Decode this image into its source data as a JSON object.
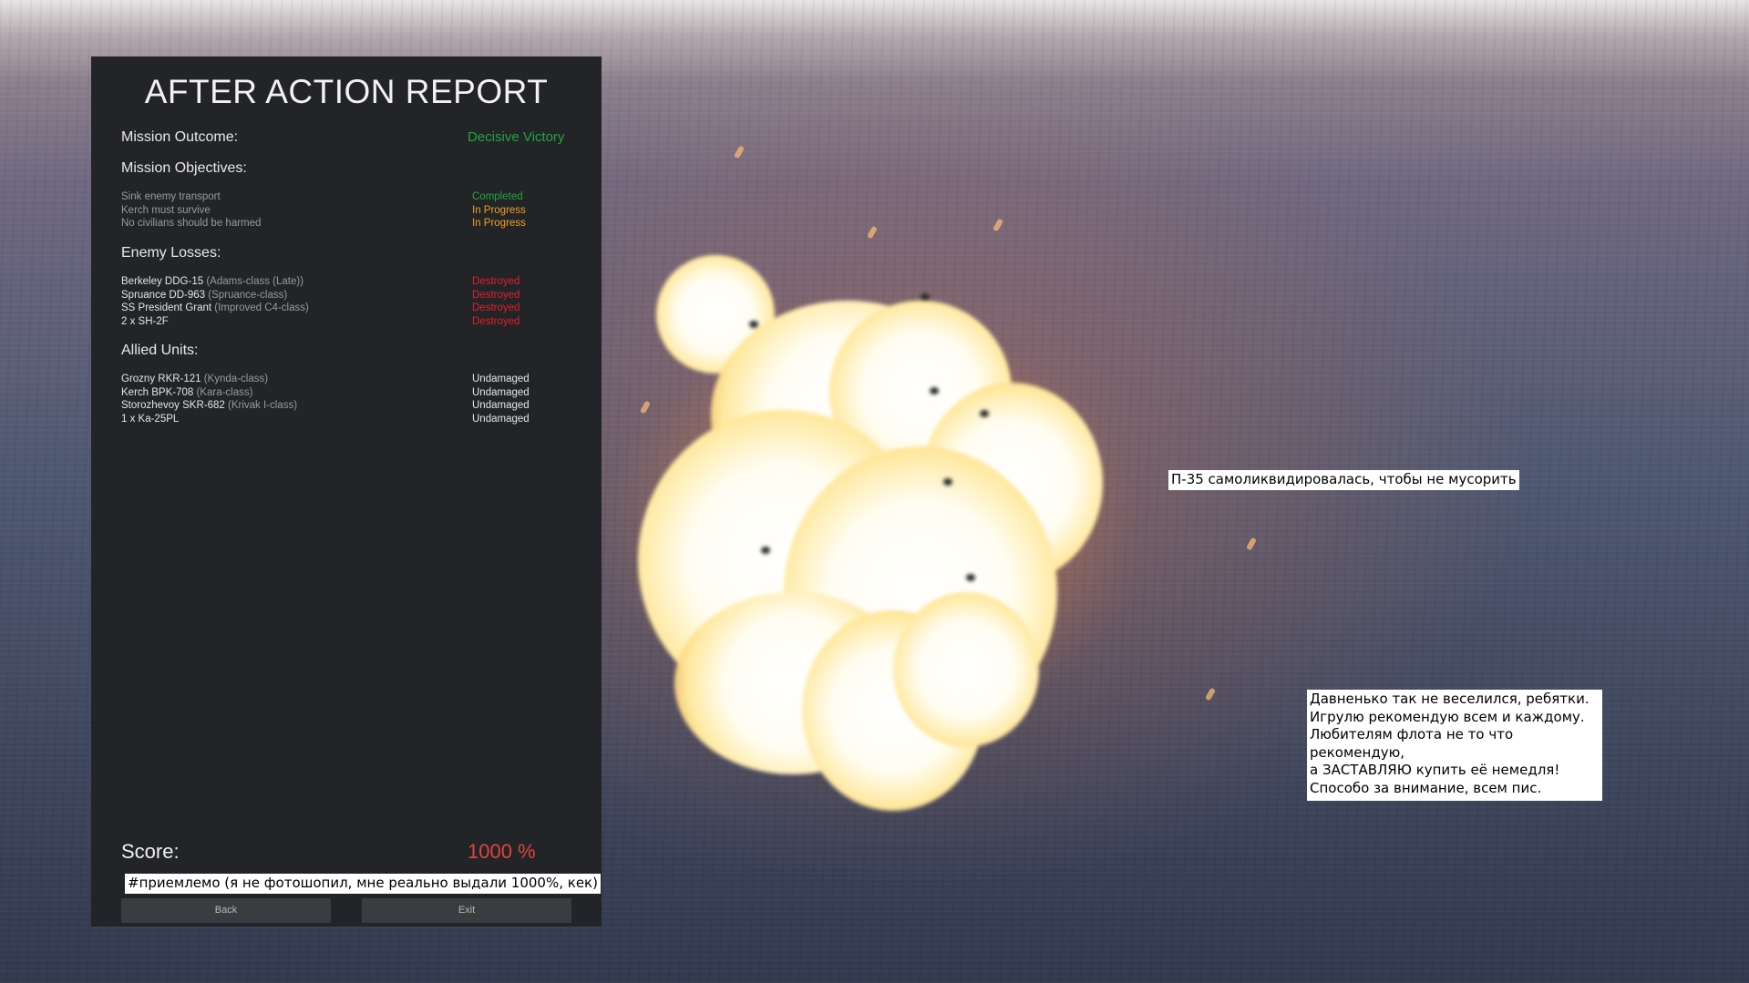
{
  "report": {
    "title": "AFTER ACTION REPORT",
    "outcome_label": "Mission Outcome:",
    "outcome_value": "Decisive Victory",
    "objectives_label": "Mission Objectives:",
    "objectives": [
      {
        "name": "Sink enemy transport",
        "status": "Completed"
      },
      {
        "name": "Kerch must survive",
        "status": "In Progress"
      },
      {
        "name": "No civilians should be harmed",
        "status": "In Progress"
      }
    ],
    "enemy_label": "Enemy Losses:",
    "enemy": [
      {
        "name": "Berkeley DDG-15",
        "cls": "(Adams-class (Late))",
        "status": "Destroyed"
      },
      {
        "name": "Spruance DD-963",
        "cls": "(Spruance-class)",
        "status": "Destroyed"
      },
      {
        "name": "SS President Grant",
        "cls": "(Improved C4-class)",
        "status": "Destroyed"
      },
      {
        "name": "2 x  SH-2F",
        "cls": "",
        "status": "Destroyed"
      }
    ],
    "allied_label": "Allied Units:",
    "allied": [
      {
        "name": "Grozny RKR-121",
        "cls": "(Kynda-class)",
        "status": "Undamaged"
      },
      {
        "name": "Kerch BPK-708",
        "cls": "(Kara-class)",
        "status": "Undamaged"
      },
      {
        "name": "Storozhevoy SKR-682",
        "cls": "(Krivak I-class)",
        "status": "Undamaged"
      },
      {
        "name": "1 x  Ka-25PL",
        "cls": "",
        "status": "Undamaged"
      }
    ],
    "score_label": "Score:",
    "score_value": "1000 %",
    "back_label": "Back",
    "exit_label": "Exit"
  },
  "captions": {
    "score_note": "#приемлемо (я не фотошопил, мне реально выдали 1000%, кек)",
    "missile_note": "П-35 самоликвидировалась, чтобы не мусорить",
    "review": "Давненько так не веселился, ребятки.\nИгрулю рекомендую всем и каждому.\nЛюбителям флота не то что рекомендую,\nа ЗАСТАВЛЯЮ купить её немедля!\nСпособо за внимание, всем пис."
  },
  "colors": {
    "victory": "#1fa83a",
    "completed": "#22a63b",
    "in_progress": "#f0a11c",
    "destroyed": "#e0202a",
    "undamaged": "#e6e6e6",
    "score": "#e0453a",
    "panel_bg": "#222428"
  }
}
